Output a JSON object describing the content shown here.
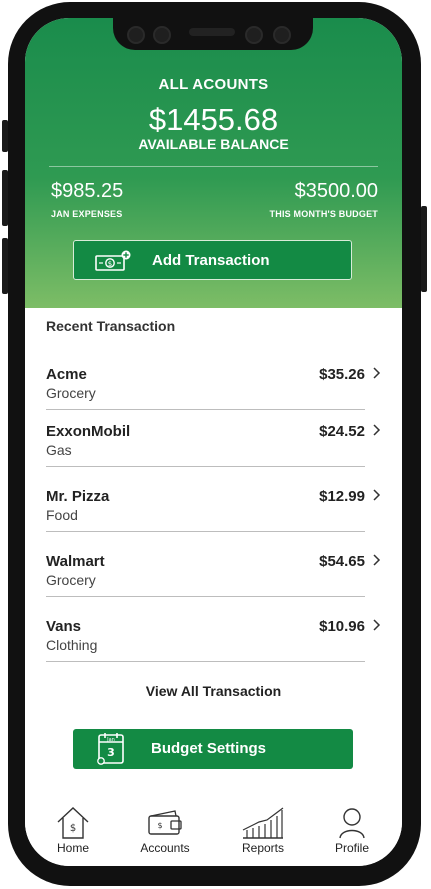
{
  "header": {
    "title": "ALL ACOUNTS",
    "balance": "$1455.68",
    "balance_label": "AVAILABLE BALANCE",
    "expenses_value": "$985.25",
    "expenses_label": "JAN EXPENSES",
    "budget_value": "$3500.00",
    "budget_label": "THIS MONTH'S BUDGET",
    "add_transaction_label": "Add Transaction"
  },
  "recent": {
    "title": "Recent Transaction",
    "items": [
      {
        "name": "Acme",
        "category": "Grocery",
        "amount": "$35.26"
      },
      {
        "name": "ExxonMobil",
        "category": "Gas",
        "amount": "$24.52"
      },
      {
        "name": "Mr. Pizza",
        "category": "Food",
        "amount": "$12.99"
      },
      {
        "name": "Walmart",
        "category": "Grocery",
        "amount": "$54.65"
      },
      {
        "name": "Vans",
        "category": "Clothing",
        "amount": "$10.96"
      }
    ],
    "view_all_label": "View All Transaction"
  },
  "budget_settings": {
    "label": "Budget Settings",
    "calendar_month": "Jan",
    "calendar_day": "3"
  },
  "tabs": [
    {
      "label": "Home",
      "icon": "home-icon"
    },
    {
      "label": "Accounts",
      "icon": "wallet-icon"
    },
    {
      "label": "Reports",
      "icon": "chart-icon"
    },
    {
      "label": "Profile",
      "icon": "profile-icon"
    }
  ],
  "colors": {
    "primary_green": "#138a44",
    "header_top": "#1a8c4c",
    "header_bottom": "#7dbd66"
  }
}
